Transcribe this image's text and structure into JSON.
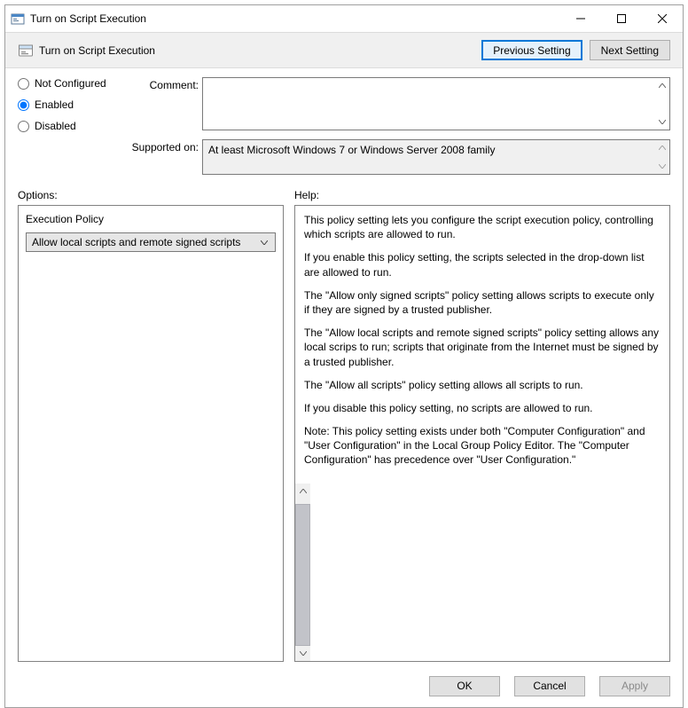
{
  "window": {
    "title": "Turn on Script Execution"
  },
  "header": {
    "policy_title": "Turn on Script Execution",
    "previous_setting": "Previous Setting",
    "next_setting": "Next Setting"
  },
  "state": {
    "not_configured": "Not Configured",
    "enabled": "Enabled",
    "disabled": "Disabled",
    "selected": "enabled"
  },
  "labels": {
    "comment": "Comment:",
    "supported_on": "Supported on:",
    "options": "Options:",
    "help": "Help:"
  },
  "supported": {
    "text": "At least Microsoft Windows 7 or Windows Server 2008 family"
  },
  "options": {
    "execution_policy_label": "Execution Policy",
    "execution_policy_value": "Allow local scripts and remote signed scripts"
  },
  "help": {
    "p1": "This policy setting lets you configure the script execution policy, controlling which scripts are allowed to run.",
    "p2": "If you enable this policy setting, the scripts selected in the drop-down list are allowed to run.",
    "p3": "The \"Allow only signed scripts\" policy setting allows scripts to execute only if they are signed by a trusted publisher.",
    "p4": "The \"Allow local scripts and remote signed scripts\" policy setting allows any local scrips to run; scripts that originate from the Internet must be signed by a trusted publisher.",
    "p5": "The \"Allow all scripts\" policy setting allows all scripts to run.",
    "p6": "If you disable this policy setting, no scripts are allowed to run.",
    "p7": "Note: This policy setting exists under both \"Computer Configuration\" and \"User Configuration\" in the Local Group Policy Editor. The \"Computer Configuration\" has precedence over \"User Configuration.\""
  },
  "footer": {
    "ok": "OK",
    "cancel": "Cancel",
    "apply": "Apply"
  }
}
